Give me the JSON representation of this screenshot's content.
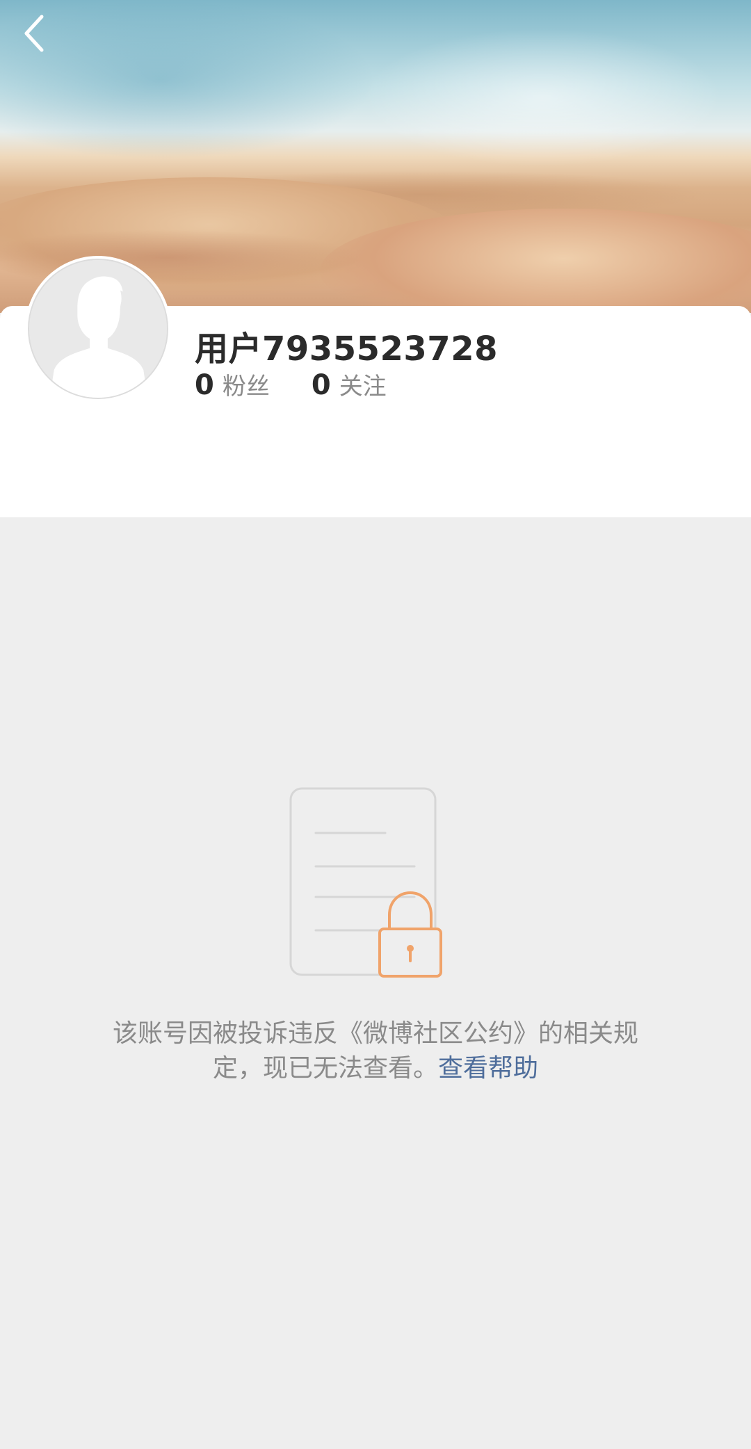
{
  "profile": {
    "username": "用户7935523728",
    "followers": {
      "count": "0",
      "label": "粉丝"
    },
    "following": {
      "count": "0",
      "label": "关注"
    }
  },
  "notice": {
    "line1": "该账号因被投诉违反《微博社区公约》的相关规",
    "line2": "定，现已无法查看。",
    "help_link": "查看帮助"
  },
  "icons": {
    "back": "chevron-left-icon",
    "avatar": "default-avatar-silhouette",
    "lock_illustration": "document-with-lock-icon"
  },
  "colors": {
    "page_bg": "#eeeeee",
    "card_bg": "#ffffff",
    "text_primary": "#2b2b2b",
    "text_secondary": "#8a8a8a",
    "link": "#4e6d9b",
    "lock_accent": "#f0a36a"
  }
}
